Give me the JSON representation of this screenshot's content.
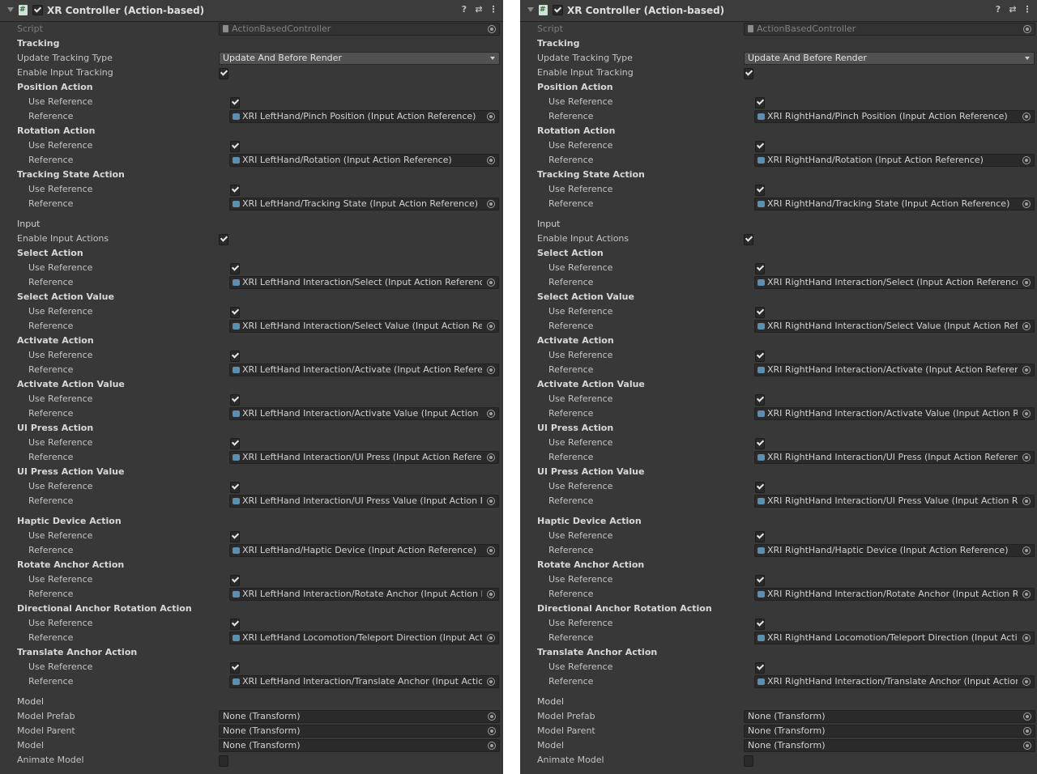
{
  "panels": [
    {
      "title": "XR Controller (Action-based)",
      "script_value": "ActionBasedController",
      "update_tracking_type_value": "Update And Before Render",
      "reference_values": [
        "XRI LeftHand/Pinch Position (Input Action Reference)",
        "XRI LeftHand/Rotation (Input Action Reference)",
        "XRI LeftHand/Tracking State (Input Action Reference)",
        "XRI LeftHand Interaction/Select (Input Action Reference)",
        "XRI LeftHand Interaction/Select Value (Input Action Referer",
        "XRI LeftHand Interaction/Activate (Input Action Reference)",
        "XRI LeftHand Interaction/Activate Value (Input Action Refer",
        "XRI LeftHand Interaction/UI Press (Input Action Reference)",
        "XRI LeftHand Interaction/UI Press Value (Input Action Refer",
        "XRI LeftHand/Haptic Device (Input Action Reference)",
        "XRI LeftHand Interaction/Rotate Anchor (Input Action Refer",
        "XRI LeftHand Locomotion/Teleport Direction (Input Action F",
        "XRI LeftHand Interaction/Translate Anchor (Input Action Re"
      ],
      "model_values": [
        "None (Transform)",
        "None (Transform)",
        "None (Transform)"
      ]
    },
    {
      "title": "XR Controller (Action-based)",
      "script_value": "ActionBasedController",
      "update_tracking_type_value": "Update And Before Render",
      "reference_values": [
        "XRI RightHand/Pinch Position (Input Action Reference)",
        "XRI RightHand/Rotation (Input Action Reference)",
        "XRI RightHand/Tracking State (Input Action Reference)",
        "XRI RightHand Interaction/Select (Input Action Reference)",
        "XRI RightHand Interaction/Select Value (Input Action Referen",
        "XRI RightHand Interaction/Activate (Input Action Reference)",
        "XRI RightHand Interaction/Activate Value (Input Action Refere",
        "XRI RightHand Interaction/UI Press (Input Action Reference)",
        "XRI RightHand Interaction/UI Press Value (Input Action Refere",
        "XRI RightHand/Haptic Device (Input Action Reference)",
        "XRI RightHand Interaction/Rotate Anchor (Input Action Refere",
        "XRI RightHand Locomotion/Teleport Direction (Input Action R",
        "XRI RightHand Interaction/Translate Anchor (Input Action Refe"
      ],
      "model_values": [
        "None (Transform)",
        "None (Transform)",
        "None (Transform)"
      ]
    }
  ],
  "labels": {
    "script": "Script",
    "tracking": "Tracking",
    "update_tracking_type": "Update Tracking Type",
    "enable_input_tracking": "Enable Input Tracking",
    "input": "Input",
    "enable_input_actions": "Enable Input Actions",
    "use_reference": "Use Reference",
    "reference": "Reference",
    "model": "Model",
    "model_prefab": "Model Prefab",
    "model_parent": "Model Parent",
    "model_field": "Model",
    "animate_model": "Animate Model",
    "actions": [
      "Position Action",
      "Rotation Action",
      "Tracking State Action",
      "Select Action",
      "Select Action Value",
      "Activate Action",
      "Activate Action Value",
      "UI Press Action",
      "UI Press Action Value",
      "Haptic Device Action",
      "Rotate Anchor Action",
      "Directional Anchor Rotation Action",
      "Translate Anchor Action"
    ]
  },
  "header_icons": [
    "help-icon",
    "presets-icon",
    "more-options-icon"
  ],
  "checkbox_states": {
    "component_enabled": true,
    "enable_input_tracking": true,
    "enable_input_actions": true,
    "use_reference": true,
    "animate_model": false
  }
}
